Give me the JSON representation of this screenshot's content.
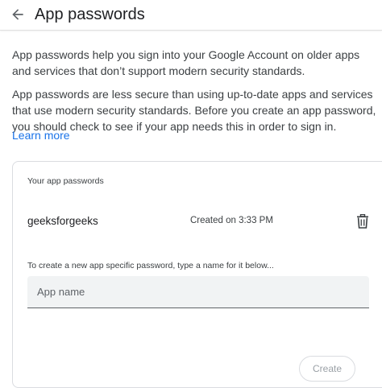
{
  "header": {
    "title": "App passwords",
    "back_icon": "arrow-back-icon"
  },
  "intro": {
    "paragraph1": "App passwords help you sign into your Google Account on older apps and services that don’t support modern security standards.",
    "paragraph2": "App passwords are less secure than using up-to-date apps and services that use modern security standards. Before you create an app password, you should check to see if your app needs this in order to sign in.",
    "learn_more": "Learn more"
  },
  "card": {
    "label": "Your app passwords",
    "passwords": [
      {
        "name": "geeksforgeeks",
        "created": "Created on 3:33 PM",
        "delete_icon": "trash-icon"
      }
    ],
    "hint": "To create a new app specific password, type a name for it below...",
    "input": {
      "placeholder": "App name",
      "value": ""
    },
    "create_label": "Create"
  },
  "colors": {
    "link": "#1a73e8",
    "text": "#202124",
    "border": "#dadce0",
    "input_bg": "#f1f3f4",
    "disabled": "#9aa0a6"
  }
}
